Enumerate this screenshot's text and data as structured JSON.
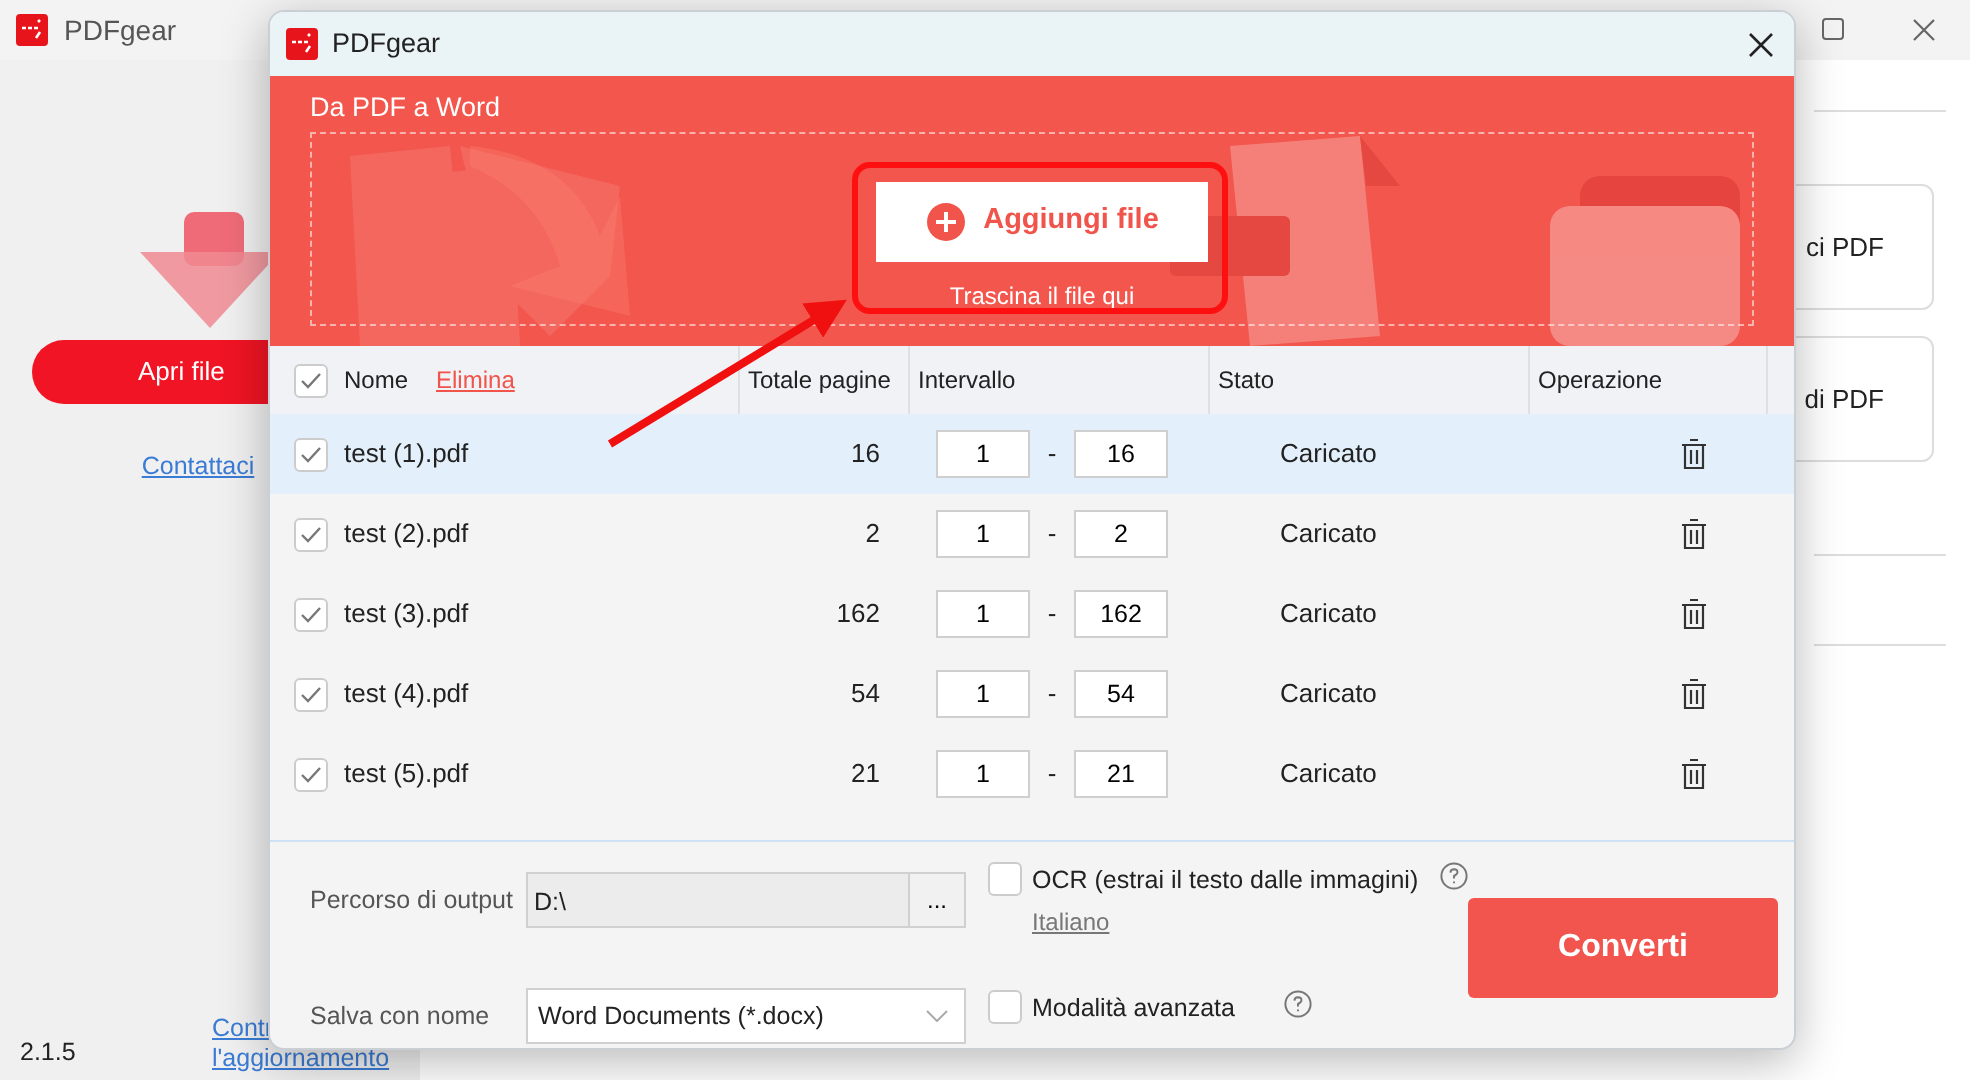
{
  "main_window": {
    "title": "PDFgear",
    "open_button": "Apri file",
    "contact_link": "Contattaci",
    "version": "2.1.5",
    "update_link": [
      "Contr",
      "l'aggiornamento"
    ],
    "cards": [
      "ci PDF",
      "di PDF"
    ]
  },
  "dialog": {
    "title": "PDFgear",
    "banner": {
      "heading": "Da PDF a Word",
      "add_button": "Aggiungi file",
      "drop_hint": "Trascina il file qui"
    },
    "table": {
      "all_checked": true,
      "delete_link": "Elimina",
      "columns": [
        "Nome",
        "Totale pagine",
        "Intervallo",
        "Stato",
        "Operazione"
      ],
      "range_separator": "-",
      "rows": [
        {
          "name": "test (1).pdf",
          "pages": "16",
          "from": "1",
          "to": "16",
          "status": "Caricato",
          "checked": true,
          "selected": true
        },
        {
          "name": "test (2).pdf",
          "pages": "2",
          "from": "1",
          "to": "2",
          "status": "Caricato",
          "checked": true,
          "selected": false
        },
        {
          "name": "test (3).pdf",
          "pages": "162",
          "from": "1",
          "to": "162",
          "status": "Caricato",
          "checked": true,
          "selected": false
        },
        {
          "name": "test (4).pdf",
          "pages": "54",
          "from": "1",
          "to": "54",
          "status": "Caricato",
          "checked": true,
          "selected": false
        },
        {
          "name": "test (5).pdf",
          "pages": "21",
          "from": "1",
          "to": "21",
          "status": "Caricato",
          "checked": true,
          "selected": false
        }
      ]
    },
    "output": {
      "label": "Percorso di output",
      "value": "D:\\",
      "browse": "..."
    },
    "ocr": {
      "label": "OCR (estrai il testo dalle immagini)",
      "checked": false,
      "language": "Italiano"
    },
    "save_as": {
      "label": "Salva con nome",
      "value": "Word Documents (*.docx)"
    },
    "advanced": {
      "label": "Modalità avanzata",
      "checked": false
    },
    "convert": "Converti"
  }
}
